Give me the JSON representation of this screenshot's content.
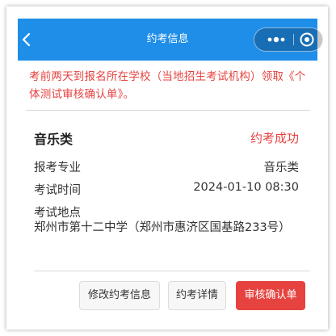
{
  "colors": {
    "nav_bg": "#1f8ee8",
    "accent_red": "#e64340",
    "divider": "#d9d9d9"
  },
  "navbar": {
    "title": "约考信息",
    "back_icon": "chevron-left-icon",
    "more_icon": "more-dots-icon",
    "close_icon": "target-close-icon"
  },
  "notice": "考前两天到报名所在学校（当地招生考试机构）领取《个体测试审核确认单》。",
  "card": {
    "title": "音乐类",
    "status": "约考成功",
    "rows": [
      {
        "label": "报考专业",
        "value": "音乐类"
      },
      {
        "label": "考试时间",
        "value": "2024-01-10 08:30"
      }
    ],
    "location_label": "考试地点",
    "location_value": "郑州市第十二中学（郑州市惠济区国基路233号）"
  },
  "actions": {
    "modify": "修改约考信息",
    "details": "约考详情",
    "confirm": "审核确认单"
  }
}
